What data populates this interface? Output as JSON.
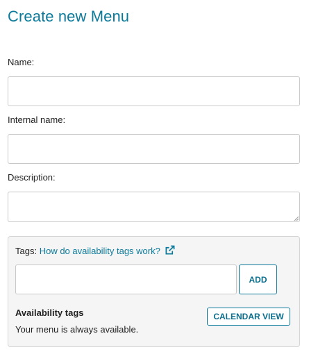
{
  "form": {
    "title": "Create new Menu",
    "name_label": "Name:",
    "name_value": "",
    "internal_name_label": "Internal name:",
    "internal_name_value": "",
    "description_label": "Description:",
    "description_value": ""
  },
  "tags": {
    "label": "Tags:",
    "help_link": "How do availability tags work?",
    "help_icon": "external-link-icon",
    "input_value": "",
    "add_button": "ADD",
    "availability_title": "Availability tags",
    "calendar_button": "CALENDAR VIEW",
    "availability_text": "Your menu is always available."
  },
  "colors": {
    "accent": "#0b7a9a",
    "panel_background": "#f5f5f5",
    "border": "#c8c8c8"
  }
}
